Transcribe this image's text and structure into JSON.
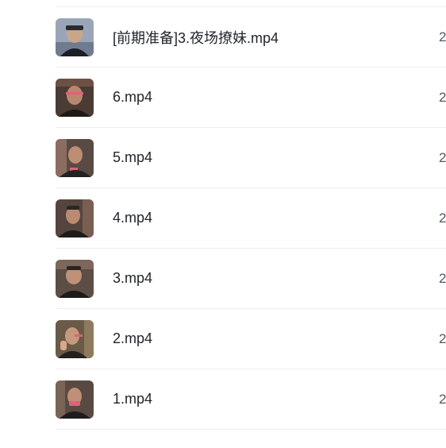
{
  "files": [
    {
      "name": "[前期准备]3.夜场撩妹.mp4",
      "size_fragment": "2",
      "thumbnail": "video-thumbnail-icon"
    },
    {
      "name": "6.mp4",
      "size_fragment": "2",
      "thumbnail": "video-thumbnail-icon"
    },
    {
      "name": "5.mp4",
      "size_fragment": "2",
      "thumbnail": "video-thumbnail-icon"
    },
    {
      "name": "4.mp4",
      "size_fragment": "2",
      "thumbnail": "video-thumbnail-icon"
    },
    {
      "name": "3.mp4",
      "size_fragment": "2",
      "thumbnail": "video-thumbnail-icon"
    },
    {
      "name": "2.mp4",
      "size_fragment": "2",
      "thumbnail": "video-thumbnail-icon"
    },
    {
      "name": "1.mp4",
      "size_fragment": "2",
      "thumbnail": "video-thumbnail-icon"
    }
  ],
  "colors": {
    "text": "#1f2329",
    "muted": "#505a66",
    "divider": "#eeeef0"
  }
}
